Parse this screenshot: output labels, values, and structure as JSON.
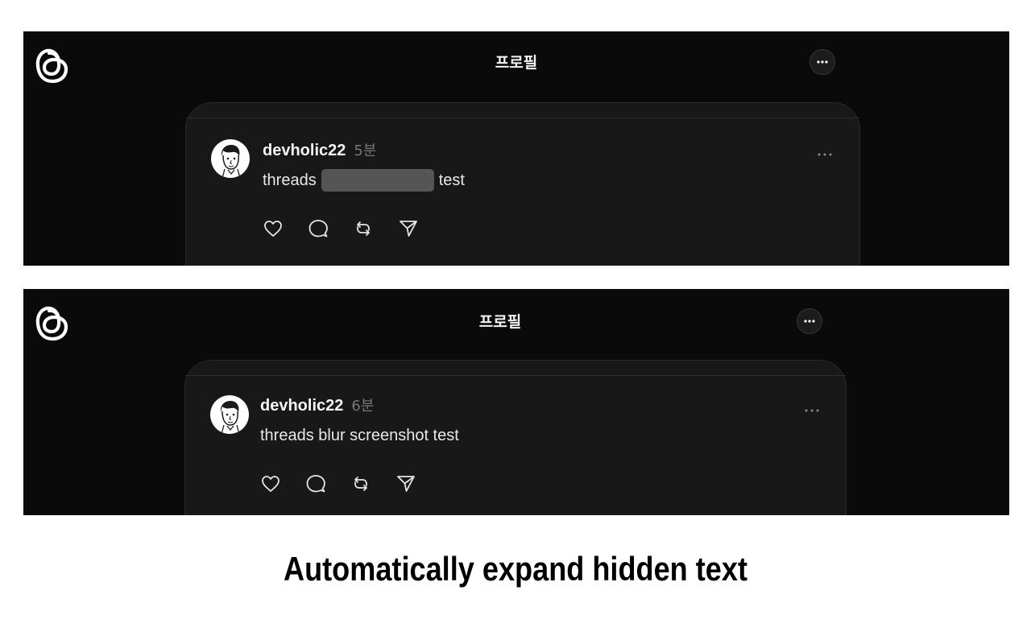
{
  "screens": {
    "before": {
      "header": {
        "title": "프로필"
      },
      "post": {
        "username": "devholic22",
        "time": "5분",
        "text_before": "threads",
        "text_after": "test"
      }
    },
    "after": {
      "header": {
        "title": "프로필"
      },
      "post": {
        "username": "devholic22",
        "time": "6분",
        "text": "threads blur screenshot test"
      }
    }
  },
  "caption": "Automatically expand hidden text",
  "icons": [
    "threads-logo-icon",
    "more-icon",
    "heart-icon",
    "comment-icon",
    "repost-icon",
    "share-icon"
  ],
  "colors": {
    "background": "#0a0a0a",
    "card": "#181818",
    "blur_block": "#555555",
    "caption": "#000000"
  }
}
